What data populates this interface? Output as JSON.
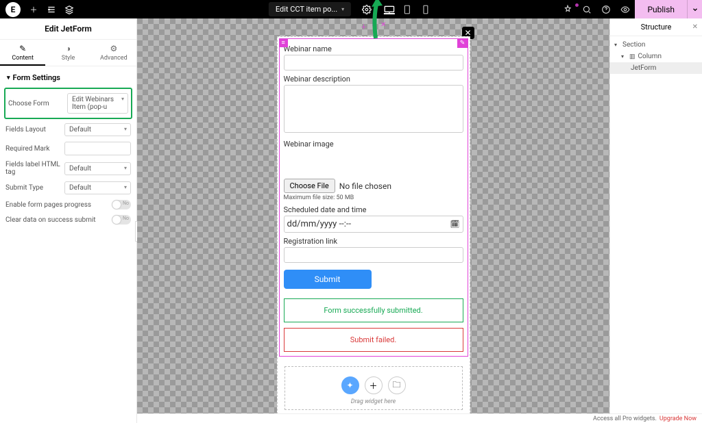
{
  "topbar": {
    "doc_title": "Edit CCT item po...",
    "publish": "Publish"
  },
  "panel": {
    "title": "Edit JetForm",
    "tabs": {
      "content": "Content",
      "style": "Style",
      "advanced": "Advanced"
    },
    "section": "Form Settings",
    "labels": {
      "choose_form": "Choose Form",
      "fields_layout": "Fields Layout",
      "required_mark": "Required Mark",
      "label_tag": "Fields label HTML tag",
      "submit_type": "Submit Type",
      "pages_progress": "Enable form pages progress",
      "clear_on_success": "Clear data on success submit"
    },
    "values": {
      "choose_form": "Edit Webinars Item (pop-u",
      "fields_layout": "Default",
      "label_tag": "Default",
      "submit_type": "Default",
      "toggle_no": "No"
    }
  },
  "form": {
    "name_label": "Webinar name",
    "desc_label": "Webinar description",
    "image_label": "Webinar image",
    "file_btn": "Choose File",
    "file_none": "No file chosen",
    "file_hint": "Maximum file size: 50 MB",
    "date_label": "Scheduled date and time",
    "date_placeholder": "dd/mm/yyyy --:--",
    "reg_label": "Registration link",
    "submit": "Submit",
    "success": "Form successfully submitted.",
    "fail": "Submit failed.",
    "drag_hint": "Drag widget here"
  },
  "structure": {
    "title": "Structure",
    "section": "Section",
    "column": "Column",
    "widget": "JetForm"
  },
  "footer": {
    "text": "Access all Pro widgets.",
    "link": "Upgrade Now"
  }
}
